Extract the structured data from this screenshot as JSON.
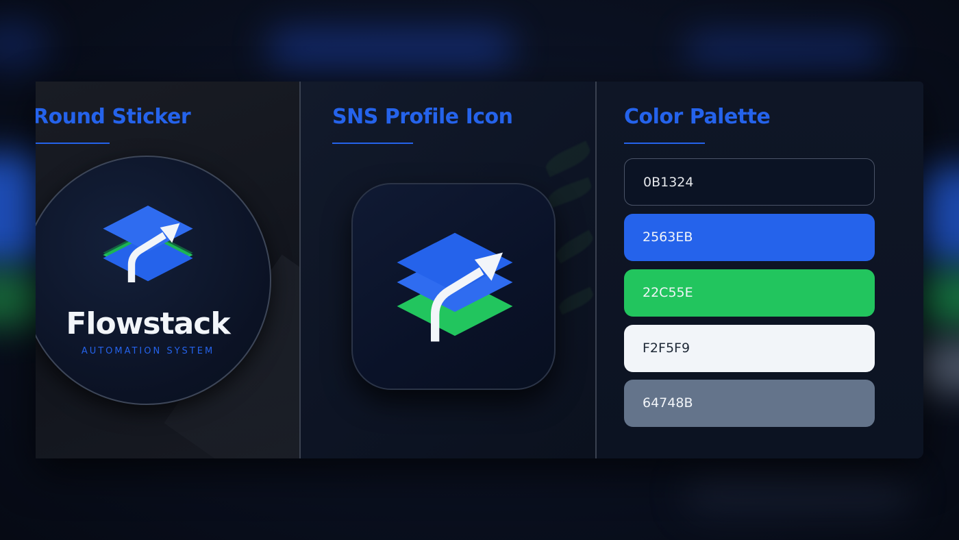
{
  "panels": {
    "sticker": {
      "title": "Round Sticker",
      "brand_name": "Flowstack",
      "tagline": "AUTOMATION SYSTEM",
      "icon": "stacked-layers-arrow-icon"
    },
    "profile": {
      "title": "SNS Profile Icon",
      "icon": "stacked-layers-arrow-icon"
    },
    "palette": {
      "title": "Color Palette",
      "swatches": [
        {
          "label": "0B1324",
          "color": "#0B1324",
          "text_color": "#E5E7EB"
        },
        {
          "label": "2563EB",
          "color": "#2563EB",
          "text_color": "#F2F5F9"
        },
        {
          "label": "22C55E",
          "color": "#22C55E",
          "text_color": "#F2F5F9"
        },
        {
          "label": "F2F5F9",
          "color": "#F2F5F9",
          "text_color": "#1F2937"
        },
        {
          "label": "64748B",
          "color": "#64748B",
          "text_color": "#F2F5F9"
        }
      ]
    }
  },
  "colors": {
    "accent_blue": "#2563EB",
    "accent_green": "#22C55E",
    "background": "#0B1324",
    "light": "#F2F5F9",
    "slate": "#64748B"
  }
}
